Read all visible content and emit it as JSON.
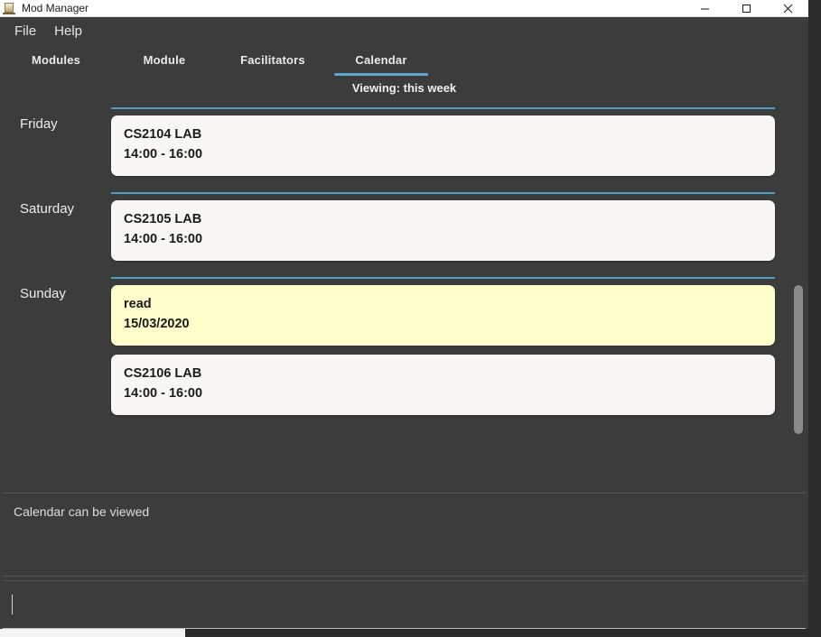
{
  "window": {
    "title": "Mod Manager",
    "icon": "app-icon",
    "controls": {
      "minimize": "minimize-icon",
      "maximize": "maximize-icon",
      "close": "close-icon"
    }
  },
  "menu": {
    "items": [
      {
        "label": "File"
      },
      {
        "label": "Help"
      }
    ]
  },
  "tabs": {
    "items": [
      {
        "label": "Modules",
        "active": false
      },
      {
        "label": "Module",
        "active": false
      },
      {
        "label": "Facilitators",
        "active": false
      },
      {
        "label": "Calendar",
        "active": true
      }
    ],
    "accent_color": "#5ba8d4"
  },
  "calendar": {
    "viewing_label": "Viewing: this week",
    "rule_color": "#4e9cc4",
    "days": [
      {
        "label": "Friday",
        "events": [
          {
            "title": "CS2104 LAB",
            "sub": "14:00 - 16:00",
            "highlight": false
          }
        ]
      },
      {
        "label": "Saturday",
        "events": [
          {
            "title": "CS2105 LAB",
            "sub": "14:00 - 16:00",
            "highlight": false
          }
        ]
      },
      {
        "label": "Sunday",
        "events": [
          {
            "title": "read",
            "sub": "15/03/2020",
            "highlight": true
          },
          {
            "title": "CS2106 LAB",
            "sub": "14:00 - 16:00",
            "highlight": false
          }
        ]
      }
    ],
    "card_color": "#f9f6f6",
    "highlight_color": "#ffffcc"
  },
  "result_panel": {
    "text": "Calendar can be viewed"
  },
  "command_input": {
    "value": "",
    "placeholder": ""
  }
}
